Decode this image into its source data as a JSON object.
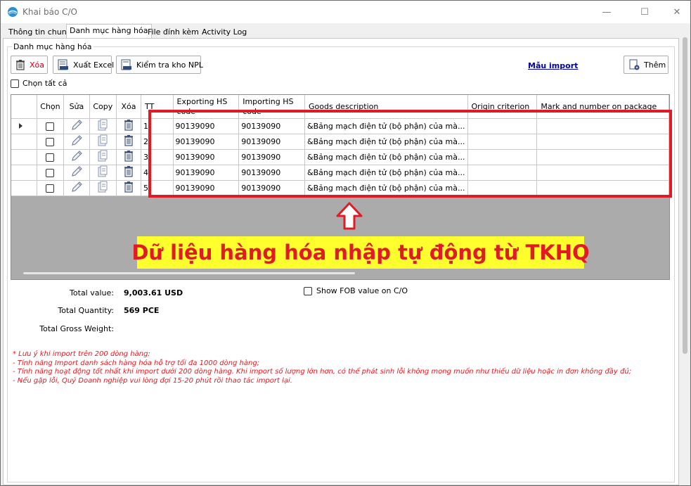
{
  "window": {
    "title": "Khai báo C/O",
    "minimize_glyph": "—",
    "maximize_glyph": "☐",
    "close_glyph": "✕"
  },
  "tabs": [
    {
      "label": "Thông tin chung",
      "active": false
    },
    {
      "label": "Danh mục hàng hóa",
      "active": true
    },
    {
      "label": "File đính kèm",
      "active": false
    },
    {
      "label": "Activity Log",
      "active": false
    }
  ],
  "group": {
    "label": "Danh mục hàng hóa"
  },
  "toolbar": {
    "delete_label": "Xóa",
    "export_label": "Xuất Excel",
    "check_npl_label": "Kiểm tra kho NPL",
    "import_template_link": "Mẫu import",
    "add_label": "Thêm"
  },
  "select_all_label": "Chọn tất cả",
  "grid": {
    "columns": {
      "select": "Chọn",
      "edit": "Sửa",
      "copy": "Copy",
      "delete": "Xóa",
      "tt": "TT",
      "exporting_hs": "Exporting HS code",
      "importing_hs": "Importing HS code",
      "goods_description": "Goods description",
      "origin_criterion": "Origin criterion",
      "marks": "Mark and number on package"
    },
    "rows": [
      {
        "tt": "1",
        "exporting_hs": "90139090",
        "importing_hs": "90139090",
        "goods_description": "&Bảng mạch điện tử (bộ phận) của mà...",
        "origin_criterion": "",
        "marks": "",
        "current": true
      },
      {
        "tt": "2",
        "exporting_hs": "90139090",
        "importing_hs": "90139090",
        "goods_description": "&Bảng mạch điện tử (bộ phận) của mà...",
        "origin_criterion": "",
        "marks": "",
        "current": false
      },
      {
        "tt": "3",
        "exporting_hs": "90139090",
        "importing_hs": "90139090",
        "goods_description": "&Bảng mạch điện tử (bộ phận) của mà...",
        "origin_criterion": "",
        "marks": "",
        "current": false
      },
      {
        "tt": "4",
        "exporting_hs": "90139090",
        "importing_hs": "90139090",
        "goods_description": "&Bảng mạch điện tử (bộ phận) của mà...",
        "origin_criterion": "",
        "marks": "",
        "current": false
      },
      {
        "tt": "5",
        "exporting_hs": "90139090",
        "importing_hs": "90139090",
        "goods_description": "&Bảng mạch điện tử (bộ phận) của mà...",
        "origin_criterion": "",
        "marks": "",
        "current": false
      }
    ]
  },
  "annotation": {
    "callout": "Dữ liệu hàng hóa nhập tự động từ TKHQ",
    "highlight_color": "#e01b24",
    "callout_background": "#ffff2e"
  },
  "summary": {
    "total_value_label": "Total value:",
    "total_value": "9,003.61 USD",
    "total_quantity_label": "Total Quantity:",
    "total_quantity": "569 PCE",
    "total_gross_weight_label": "Total Gross Weight:",
    "total_gross_weight": "",
    "show_fob_label": "Show FOB value on C/O"
  },
  "notes": [
    "* Lưu ý khi import trên 200 dòng hàng:",
    "- Tính năng Import danh sách hàng hóa hỗ trợ tối đa 1000 dòng hàng;",
    "- Tính năng hoạt động tốt nhất khi import dưới 200 dòng hàng. Khi import số lượng lớn hơn, có thể phát sinh lỗi không mong muốn như thiếu dữ liệu hoặc in đơn không đầy đủ;",
    "- Nếu gặp lỗi, Quý Doanh nghiệp vui lòng đợi 15-20 phút rồi thao tác import lại."
  ],
  "icons": {
    "app": "globe-icon",
    "delete": "trash-icon",
    "export": "excel-icon",
    "check": "document-check-icon",
    "add": "document-add-icon",
    "edit": "pencil-icon",
    "copy": "copy-icon"
  }
}
